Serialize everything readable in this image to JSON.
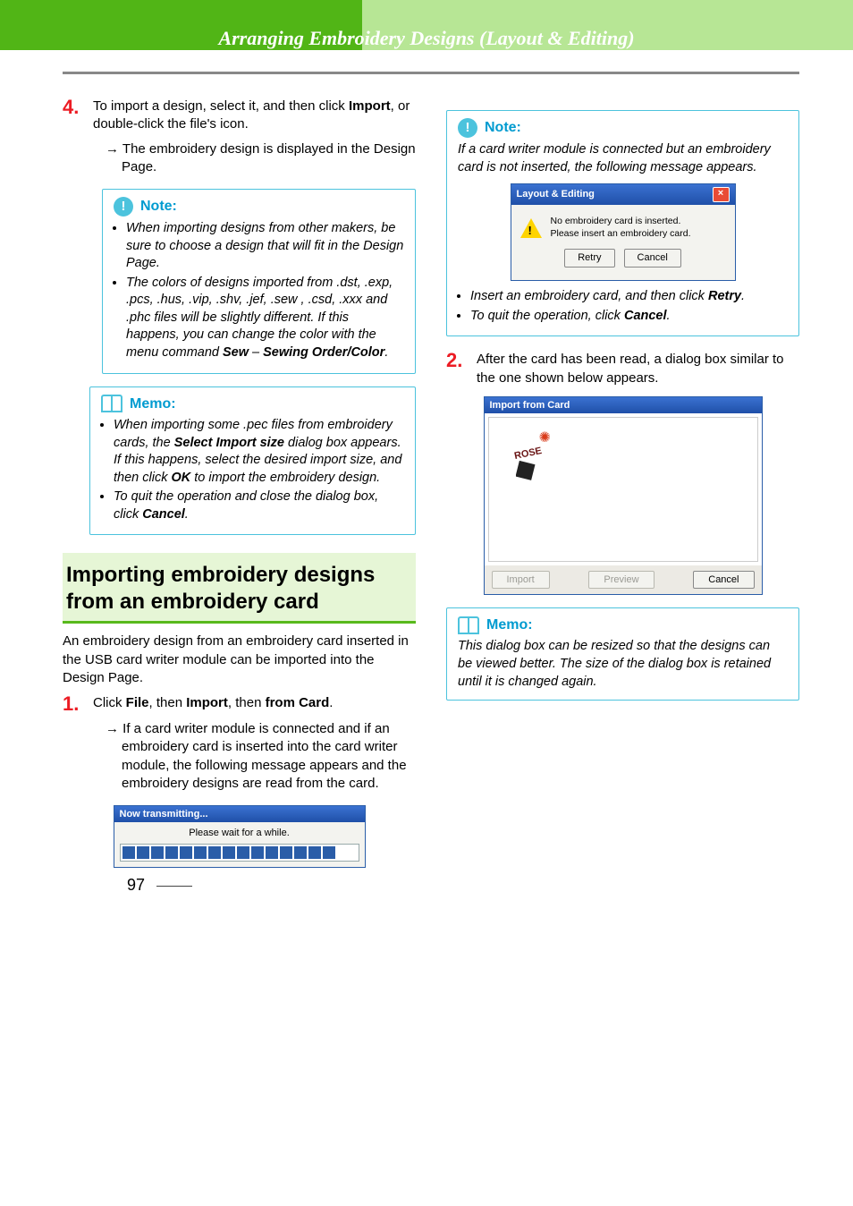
{
  "header": {
    "chapter_title": "Arranging Embroidery Designs (Layout & Editing)"
  },
  "left": {
    "step4": {
      "num": "4.",
      "text_a": "To import a design, select it, and then click ",
      "bold_a": "Import",
      "text_b": ", or double-click the file's icon.",
      "arrow": "The embroidery design is displayed in the Design Page."
    },
    "note1": {
      "label": "Note:",
      "b1": "When importing designs from other makers, be sure to choose a design that will fit in the Design Page.",
      "b2_a": "The colors of designs imported from .dst, .exp, .pcs, .hus, .vip, .shv, .jef, .sew , .csd, .xxx and .phc files will be slightly different. If this happens, you can change the color with the menu command ",
      "b2_bold1": "Sew",
      "b2_mid": " – ",
      "b2_bold2": "Sewing Order/Color",
      "b2_end": "."
    },
    "memo1": {
      "label": "Memo:",
      "b1_a": "When importing some .pec files from embroidery cards, the ",
      "b1_bold1": "Select Import size",
      "b1_b": " dialog box appears. If this happens, select the desired import size, and then click ",
      "b1_bold2": "OK",
      "b1_c": " to import the embroidery design.",
      "b2_a": "To quit the operation and close the dialog box, click ",
      "b2_bold": "Cancel",
      "b2_b": "."
    },
    "section_heading": "Importing embroidery designs from an embroidery card",
    "section_intro": "An embroidery design from an embroidery card inserted in the USB card writer module can be imported into the Design Page.",
    "step1": {
      "num": "1.",
      "a": "Click ",
      "b1": "File",
      "c": ", then ",
      "b2": "Import",
      "d": ", then ",
      "b3": "from Card",
      "e": ".",
      "arrow": "If a card writer module is connected and if an embroidery card is inserted into the card writer module, the following message appears and the embroidery designs are read from the card."
    },
    "transmit_dialog": {
      "title": "Now transmitting...",
      "body": "Please wait for a while."
    }
  },
  "right": {
    "note2": {
      "label": "Note:",
      "intro": "If a card writer module is connected but an embroidery card is not inserted, the following message appears.",
      "dlg_title": "Layout & Editing",
      "dlg_msg1": "No embroidery card is inserted.",
      "dlg_msg2": "Please insert an embroidery card.",
      "dlg_retry": "Retry",
      "dlg_cancel": "Cancel",
      "b1_a": "Insert an embroidery card, and then click ",
      "b1_bold": "Retry",
      "b1_b": ".",
      "b2_a": "To quit the operation, click ",
      "b2_bold": "Cancel",
      "b2_b": "."
    },
    "step2": {
      "num": "2.",
      "text": "After the card has been read, a dialog box similar to the one shown below appears."
    },
    "import_dialog": {
      "title": "Import from Card",
      "rose_label": "ROSE",
      "btn_import": "Import",
      "btn_preview": "Preview",
      "btn_cancel": "Cancel"
    },
    "memo2": {
      "label": "Memo:",
      "text": "This dialog box can be resized so that the designs can be viewed better. The size of the dialog box is retained until it is changed again."
    }
  },
  "page_number": "97"
}
